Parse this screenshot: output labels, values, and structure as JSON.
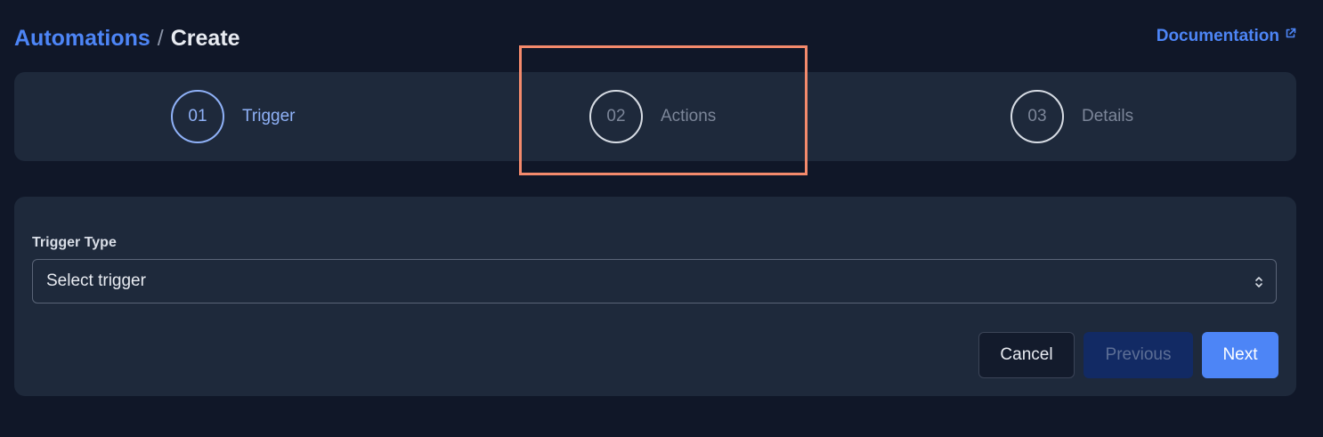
{
  "breadcrumb": {
    "parent": "Automations",
    "separator": "/",
    "current": "Create"
  },
  "header": {
    "documentation_label": "Documentation"
  },
  "steps": [
    {
      "number": "01",
      "label": "Trigger",
      "active": true
    },
    {
      "number": "02",
      "label": "Actions",
      "active": false
    },
    {
      "number": "03",
      "label": "Details",
      "active": false
    }
  ],
  "form": {
    "trigger_type_label": "Trigger Type",
    "trigger_select_value": "Select trigger"
  },
  "buttons": {
    "cancel": "Cancel",
    "previous": "Previous",
    "next": "Next"
  },
  "colors": {
    "background": "#101728",
    "card": "#1e293b",
    "accent": "#4d85f6",
    "active_step": "#8fb1f7",
    "highlight": "#f48a6c"
  },
  "icons": {
    "documentation": "external-link-icon",
    "select": "chevron-up-down-icon"
  }
}
